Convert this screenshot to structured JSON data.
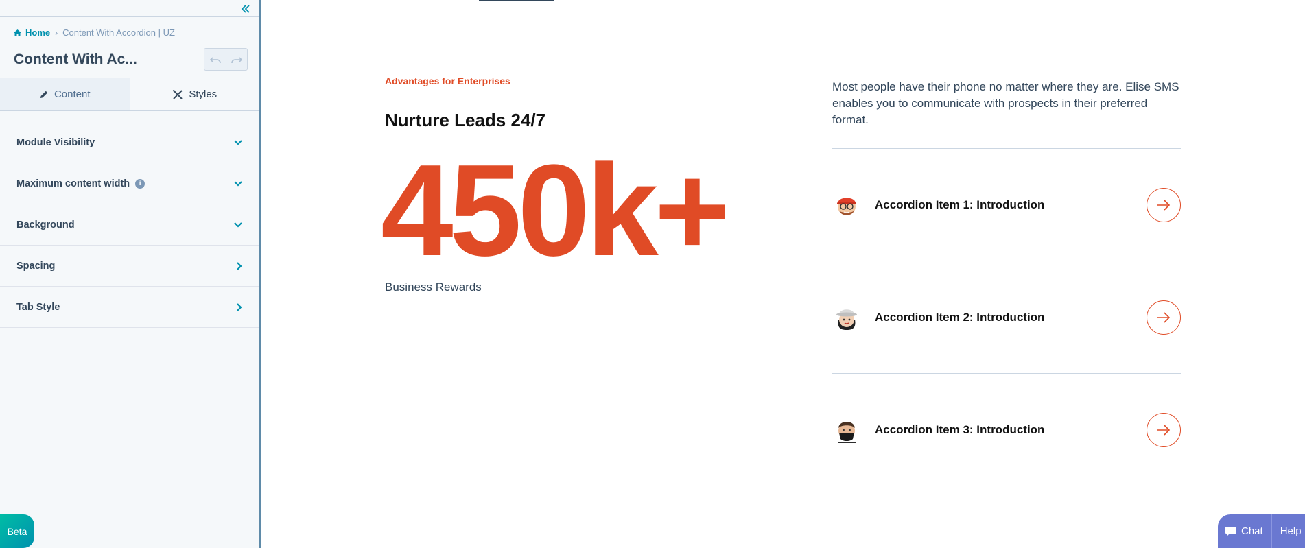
{
  "sidebar": {
    "breadcrumb": {
      "home_label": "Home",
      "current_label": "Content With Accordion | UZ"
    },
    "page_title": "Content With Ac...",
    "tabs": [
      {
        "label": "Content",
        "icon": "pencil-icon",
        "active": false
      },
      {
        "label": "Styles",
        "icon": "styles-icon",
        "active": true
      }
    ],
    "sections": [
      {
        "label": "Module Visibility",
        "chevron": "down"
      },
      {
        "label": "Maximum content width",
        "chevron": "down",
        "info": true
      },
      {
        "label": "Background",
        "chevron": "down"
      },
      {
        "label": "Spacing",
        "chevron": "right"
      },
      {
        "label": "Tab Style",
        "chevron": "right"
      }
    ],
    "beta_label": "Beta"
  },
  "preview": {
    "eyebrow": "Advantages for Enterprises",
    "heading": "Nurture Leads 24/7",
    "stat_value": "450k+",
    "stat_label": "Business Rewards",
    "intro_text": "Most people have their phone no matter where they are. Elise SMS enables you to communicate with prospects in their preferred format.",
    "accordion": [
      {
        "title": "Accordion Item 1: Introduction",
        "avatar": "memoji-red-cap-glasses"
      },
      {
        "title": "Accordion Item 2: Introduction",
        "avatar": "memoji-white-hat-woman"
      },
      {
        "title": "Accordion Item 3: Introduction",
        "avatar": "memoji-mask-man"
      }
    ]
  },
  "widget": {
    "chat_label": "Chat",
    "help_label": "Help"
  },
  "colors": {
    "accent": "#e04b26",
    "teal": "#0091ae",
    "sidebar_bg": "#f5f8fa",
    "widget": "#6a78d1"
  }
}
